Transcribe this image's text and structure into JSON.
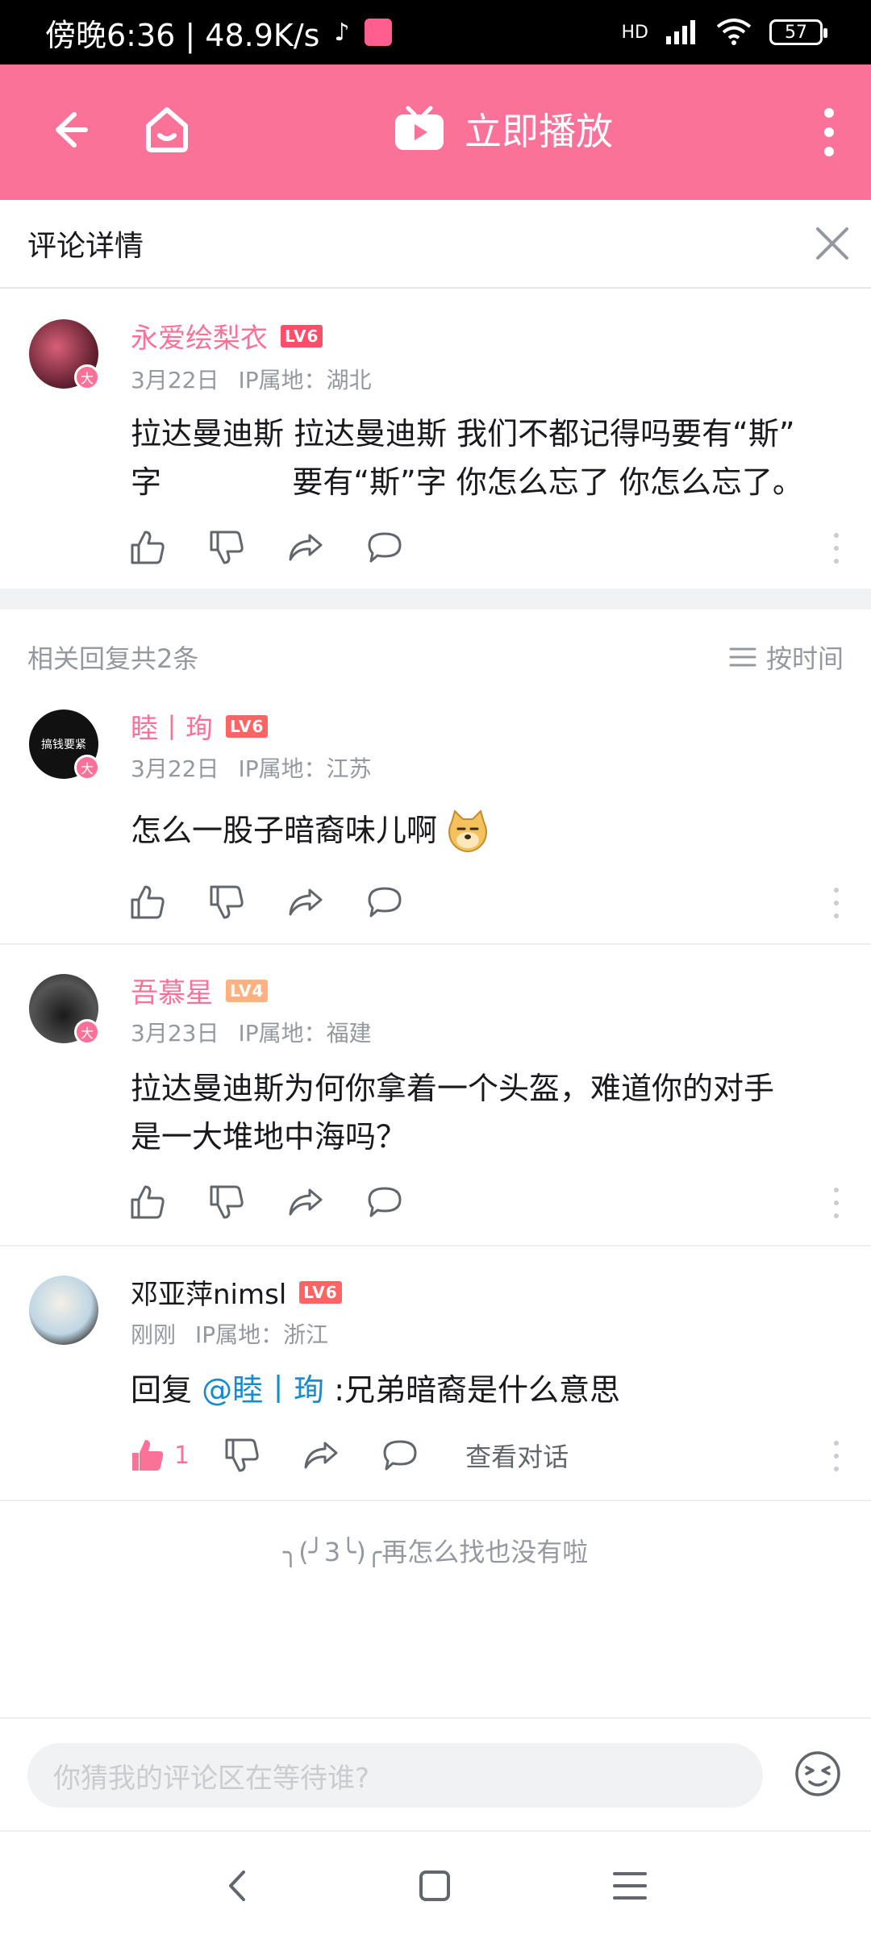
{
  "status_bar": {
    "time_speed": "傍晚6:36 | 48.9K/s",
    "network": "HD",
    "battery": "57"
  },
  "top_bar": {
    "play_now_label": "立即播放"
  },
  "detail_header": {
    "title": "评论详情"
  },
  "root_comment": {
    "username": "永爱绘梨衣",
    "level": "LV6",
    "date": "3月22日",
    "ip": "IP属地：湖北",
    "text_line1": "拉达曼迪斯 拉达曼迪斯 我们不都记得吗要有“斯”",
    "text_line2": "字 　 　 　 要有“斯”字 你怎么忘了 你怎么忘了。"
  },
  "related": {
    "count_label": "相关回复共2条",
    "sort_label": "按时间"
  },
  "replies": [
    {
      "username": "睦丨珣",
      "level": "LV6",
      "date": "3月22日",
      "ip": "IP属地：江苏",
      "text": "怎么一股子暗裔味儿啊",
      "avatar_text": "搞钱要紧"
    },
    {
      "username": "吾慕星",
      "level": "LV4",
      "date": "3月23日",
      "ip": "IP属地：福建",
      "text_line1": "拉达曼迪斯为何你拿着一个头盔，难道你的对手",
      "text_line2": "是一大堆地中海吗？"
    },
    {
      "username": "邓亚萍nimsl",
      "level": "LV6",
      "date": "刚刚",
      "ip": "IP属地：浙江",
      "reply_prefix": "回复",
      "mention": "@睦丨珣",
      "text": ":兄弟暗裔是什么意思",
      "like_count": "1",
      "view_dialog": "查看对话"
    }
  ],
  "avatar_badge": "大",
  "end_text": "╮(╯3╰)╭再怎么找也没有啦",
  "input": {
    "placeholder": "你猜我的评论区在等待谁?"
  },
  "colors": {
    "brand_pink": "#fb7299",
    "mention_blue": "#178bcf",
    "secondary_text": "#9499a0"
  }
}
